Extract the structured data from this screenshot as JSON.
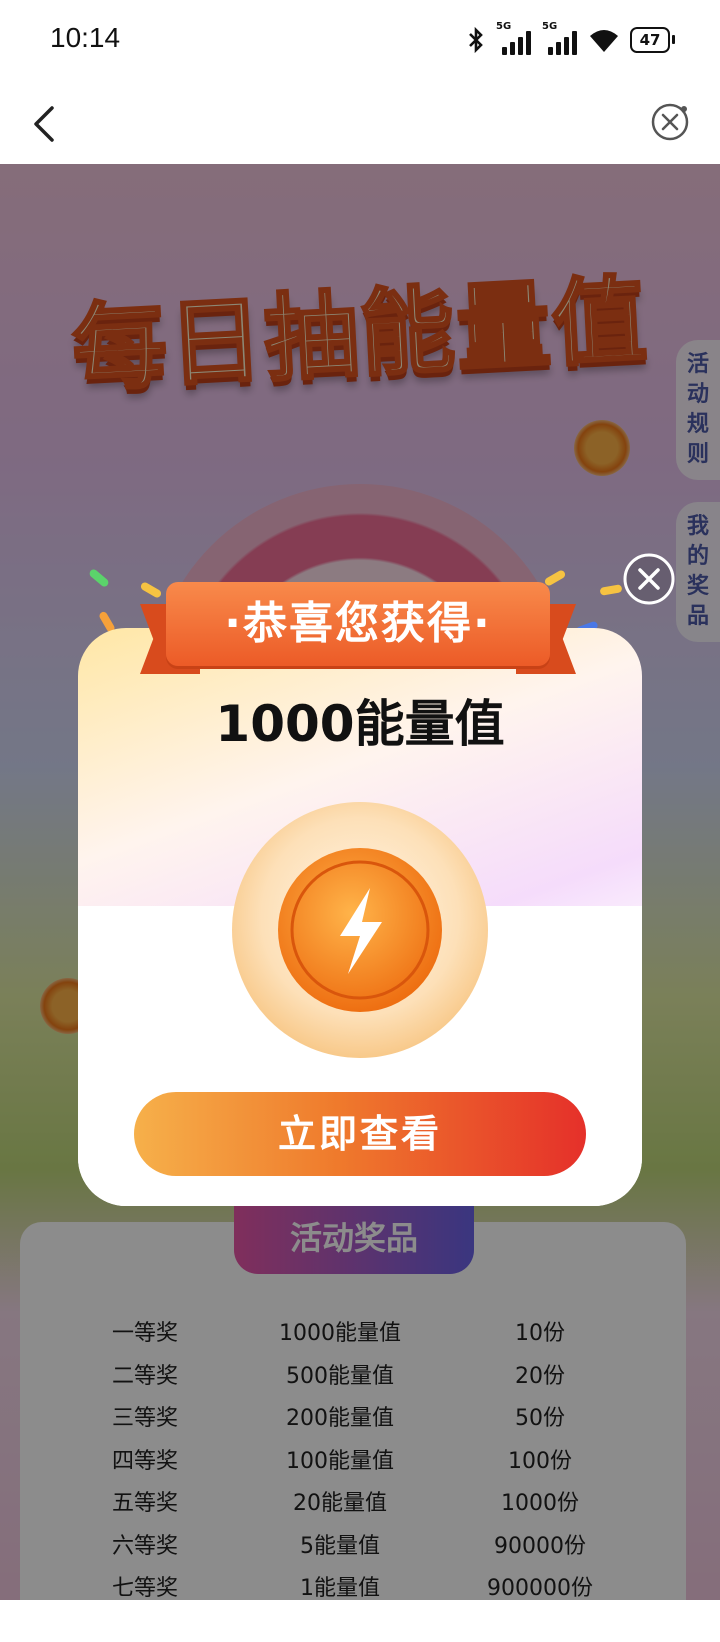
{
  "status_bar": {
    "time": "10:14",
    "battery": "47",
    "network_tag": "5G"
  },
  "background": {
    "banner_title": "每日抽能量值",
    "side_tabs": [
      "活动规则",
      "我的奖品"
    ],
    "prize_header": "活动奖品",
    "prizes": [
      {
        "rank": "一等奖",
        "reward": "1000能量值",
        "count": "10份"
      },
      {
        "rank": "二等奖",
        "reward": "500能量值",
        "count": "20份"
      },
      {
        "rank": "三等奖",
        "reward": "200能量值",
        "count": "50份"
      },
      {
        "rank": "四等奖",
        "reward": "100能量值",
        "count": "100份"
      },
      {
        "rank": "五等奖",
        "reward": "20能量值",
        "count": "1000份"
      },
      {
        "rank": "六等奖",
        "reward": "5能量值",
        "count": "90000份"
      },
      {
        "rank": "七等奖",
        "reward": "1能量值",
        "count": "900000份"
      }
    ]
  },
  "dialog": {
    "ribbon_title": "·恭喜您获得·",
    "amount": "1000能量值",
    "button_label": "立即查看"
  },
  "colors": {
    "accent_orange": "#ec5b27",
    "button_start": "#f6b04a",
    "button_end": "#e5302a"
  }
}
